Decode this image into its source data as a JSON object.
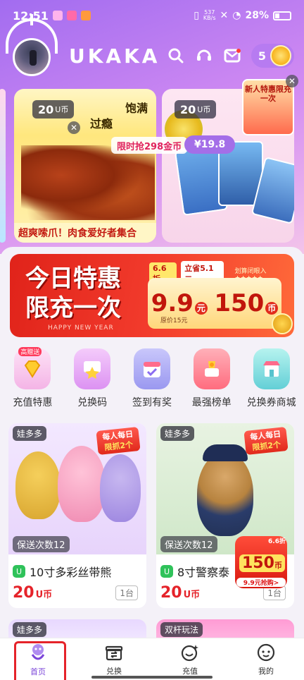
{
  "status_bar": {
    "time": "12:51",
    "speed_value": "537",
    "speed_unit": "KB/s",
    "battery": "28%"
  },
  "header": {
    "logo": "UKAKA",
    "coin_count": "5"
  },
  "banners": [
    {
      "tag_value": "20",
      "tag_unit": "U币",
      "word_1": "过瘾",
      "word_2": "饱满",
      "slogan": "超爽嗦爪！肉食爱好者集合"
    },
    {
      "tag_value": "20",
      "tag_unit": "U币"
    }
  ],
  "promo_strip": {
    "text": "限时抢298金币",
    "price": "¥19.8"
  },
  "float_gift": {
    "text": "新人特惠限充一次"
  },
  "big_promo": {
    "title_line1": "今日特惠",
    "title_line2": "限充一次",
    "subtitle": "HAPPY NEW YEAR",
    "discount": "6.6折",
    "save": "立省5.1元",
    "limit": "划算闭眼入 ★★★★★",
    "price": "9.9",
    "price_unit": "元",
    "coins": "150",
    "coins_unit": "币",
    "original": "原价15元"
  },
  "quick_actions": [
    {
      "label": "充值特惠",
      "badge": "高赠送",
      "color": "#f7c3f0"
    },
    {
      "label": "兑换码",
      "badge": "",
      "color": "#e7a8f5"
    },
    {
      "label": "签到有奖",
      "badge": "",
      "color": "#a9a7f6"
    },
    {
      "label": "最强榜单",
      "badge": "",
      "color": "#ff7f8f"
    },
    {
      "label": "兑换券商城",
      "badge": "",
      "color": "#7fe1e0"
    }
  ],
  "products": [
    {
      "corner_label": "娃多多",
      "daily_line1": "每人每日",
      "daily_line2": "限抓2个",
      "times": "保送次数12",
      "title": "10寸多彩丝带熊",
      "price": "20",
      "price_unit": "U币",
      "stock": "1台"
    },
    {
      "corner_label": "娃多多",
      "daily_line1": "每人每日",
      "daily_line2": "限抓2个",
      "times": "保送次数12",
      "title": "8寸警察泰",
      "price": "20",
      "price_unit": "U币",
      "stock": "1台"
    }
  ],
  "float_150": {
    "pct": "6.6折",
    "value": "150",
    "unit": "币",
    "label": "9.9元抢购>"
  },
  "peek_items": [
    {
      "corner_label": "娃多多"
    },
    {
      "corner_label": "双杆玩法"
    }
  ],
  "tabs": [
    {
      "label": "首页"
    },
    {
      "label": "兑换"
    },
    {
      "label": "充值"
    },
    {
      "label": "我的"
    }
  ]
}
